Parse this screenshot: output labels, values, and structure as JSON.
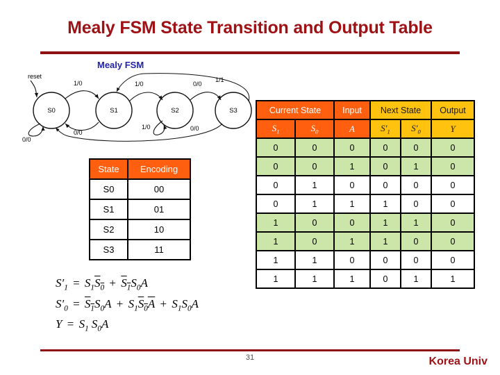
{
  "slide": {
    "title": "Mealy FSM State Transition and Output Table",
    "page_number": "31",
    "brand": "Korea Univ",
    "accent_color": "#9E1216",
    "header_orange": "#FF5F0F",
    "header_yellow": "#FFC20E",
    "row_green": "#CCE5A8"
  },
  "fsm": {
    "caption": "Mealy FSM",
    "reset_label": "reset",
    "states": [
      {
        "name": "S0"
      },
      {
        "name": "S1"
      },
      {
        "name": "S2"
      },
      {
        "name": "S3"
      }
    ],
    "transitions": [
      {
        "label": "0/0",
        "from": "S0",
        "to": "S0",
        "kind": "self"
      },
      {
        "label": "1/0",
        "from": "S0",
        "to": "S1",
        "kind": "forward"
      },
      {
        "label": "0/0",
        "from": "S1",
        "to": "S0",
        "kind": "back"
      },
      {
        "label": "1/0",
        "from": "S1",
        "to": "S2",
        "kind": "forward"
      },
      {
        "label": "1/0",
        "from": "S2",
        "to": "S2",
        "kind": "self"
      },
      {
        "label": "0/0",
        "from": "S2",
        "to": "S3",
        "kind": "forward"
      },
      {
        "label": "1/1",
        "from": "S3",
        "to": "S1",
        "kind": "long-back-top"
      },
      {
        "label": "0/0",
        "from": "S3",
        "to": "S0",
        "kind": "long-back-bottom"
      }
    ]
  },
  "encoding_table": {
    "headers": [
      "State",
      "Encoding"
    ],
    "rows": [
      [
        "S0",
        "00"
      ],
      [
        "S1",
        "01"
      ],
      [
        "S2",
        "10"
      ],
      [
        "S3",
        "11"
      ]
    ]
  },
  "transition_table": {
    "group_headers": [
      {
        "label": "Current State",
        "span": 2,
        "style": "orange"
      },
      {
        "label": "Input",
        "span": 1,
        "style": "orange"
      },
      {
        "label": "Next State",
        "span": 2,
        "style": "yellow"
      },
      {
        "label": "Output",
        "span": 1,
        "style": "yellow"
      }
    ],
    "sub_headers": [
      {
        "base": "S",
        "sub": "1",
        "prime": false,
        "style": "orange"
      },
      {
        "base": "S",
        "sub": "0",
        "prime": false,
        "style": "orange"
      },
      {
        "base": "A",
        "sub": "",
        "prime": false,
        "style": "orange"
      },
      {
        "base": "S",
        "sub": "1",
        "prime": true,
        "style": "yellow"
      },
      {
        "base": "S",
        "sub": "0",
        "prime": true,
        "style": "yellow"
      },
      {
        "base": "Y",
        "sub": "",
        "prime": false,
        "style": "yellow"
      }
    ],
    "rows": [
      {
        "shade": "green",
        "cells": [
          "0",
          "0",
          "0",
          "0",
          "0",
          "0"
        ]
      },
      {
        "shade": "green",
        "cells": [
          "0",
          "0",
          "1",
          "0",
          "1",
          "0"
        ]
      },
      {
        "shade": "white",
        "cells": [
          "0",
          "1",
          "0",
          "0",
          "0",
          "0"
        ]
      },
      {
        "shade": "white",
        "cells": [
          "0",
          "1",
          "1",
          "1",
          "0",
          "0"
        ]
      },
      {
        "shade": "green",
        "cells": [
          "1",
          "0",
          "0",
          "1",
          "1",
          "0"
        ]
      },
      {
        "shade": "green",
        "cells": [
          "1",
          "0",
          "1",
          "1",
          "0",
          "0"
        ]
      },
      {
        "shade": "white",
        "cells": [
          "1",
          "1",
          "0",
          "0",
          "0",
          "0"
        ]
      },
      {
        "shade": "white",
        "cells": [
          "1",
          "1",
          "1",
          "0",
          "1",
          "1"
        ]
      }
    ]
  },
  "equations": [
    {
      "id": "next-s1",
      "text": "S'1 = S1 S0' + S1' S0 A"
    },
    {
      "id": "next-s0",
      "text": "S'0 = S1' S0 A + S1 S0' A' + S1 S0 A"
    },
    {
      "id": "output-y",
      "text": "Y = S1 S0 A"
    }
  ]
}
